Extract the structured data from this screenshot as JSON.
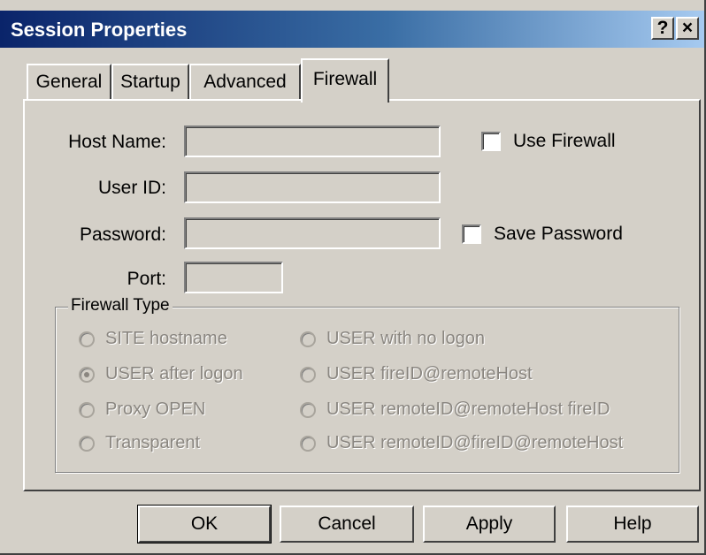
{
  "window": {
    "title": "Session Properties",
    "help_glyph": "?",
    "close_glyph": "×"
  },
  "tabs": [
    {
      "label": "General",
      "active": false
    },
    {
      "label": "Startup",
      "active": false
    },
    {
      "label": "Advanced",
      "active": false
    },
    {
      "label": "Firewall",
      "active": true
    }
  ],
  "form": {
    "host_name_label": "Host Name:",
    "host_name_value": "",
    "user_id_label": "User ID:",
    "user_id_value": "",
    "password_label": "Password:",
    "password_value": "",
    "port_label": "Port:",
    "port_value": "",
    "use_firewall_label": "Use Firewall",
    "use_firewall_checked": false,
    "save_password_label": "Save Password",
    "save_password_checked": false
  },
  "firewall_type": {
    "title": "Firewall Type",
    "options": [
      {
        "label": "SITE hostname",
        "selected": false,
        "enabled": false
      },
      {
        "label": "USER after logon",
        "selected": true,
        "enabled": false
      },
      {
        "label": "Proxy OPEN",
        "selected": false,
        "enabled": false
      },
      {
        "label": "Transparent",
        "selected": false,
        "enabled": false
      },
      {
        "label": "USER with no logon",
        "selected": false,
        "enabled": false
      },
      {
        "label": "USER fireID@remoteHost",
        "selected": false,
        "enabled": false
      },
      {
        "label": "USER remoteID@remoteHost fireID",
        "selected": false,
        "enabled": false
      },
      {
        "label": "USER remoteID@fireID@remoteHost",
        "selected": false,
        "enabled": false
      }
    ]
  },
  "buttons": {
    "ok": "OK",
    "cancel": "Cancel",
    "apply": "Apply",
    "help": "Help"
  },
  "colors": {
    "dialog_face": "#d4d0c8",
    "title_gradient_start": "#0a246a",
    "title_gradient_end": "#a6caf0",
    "disabled_text": "#8a8680"
  }
}
